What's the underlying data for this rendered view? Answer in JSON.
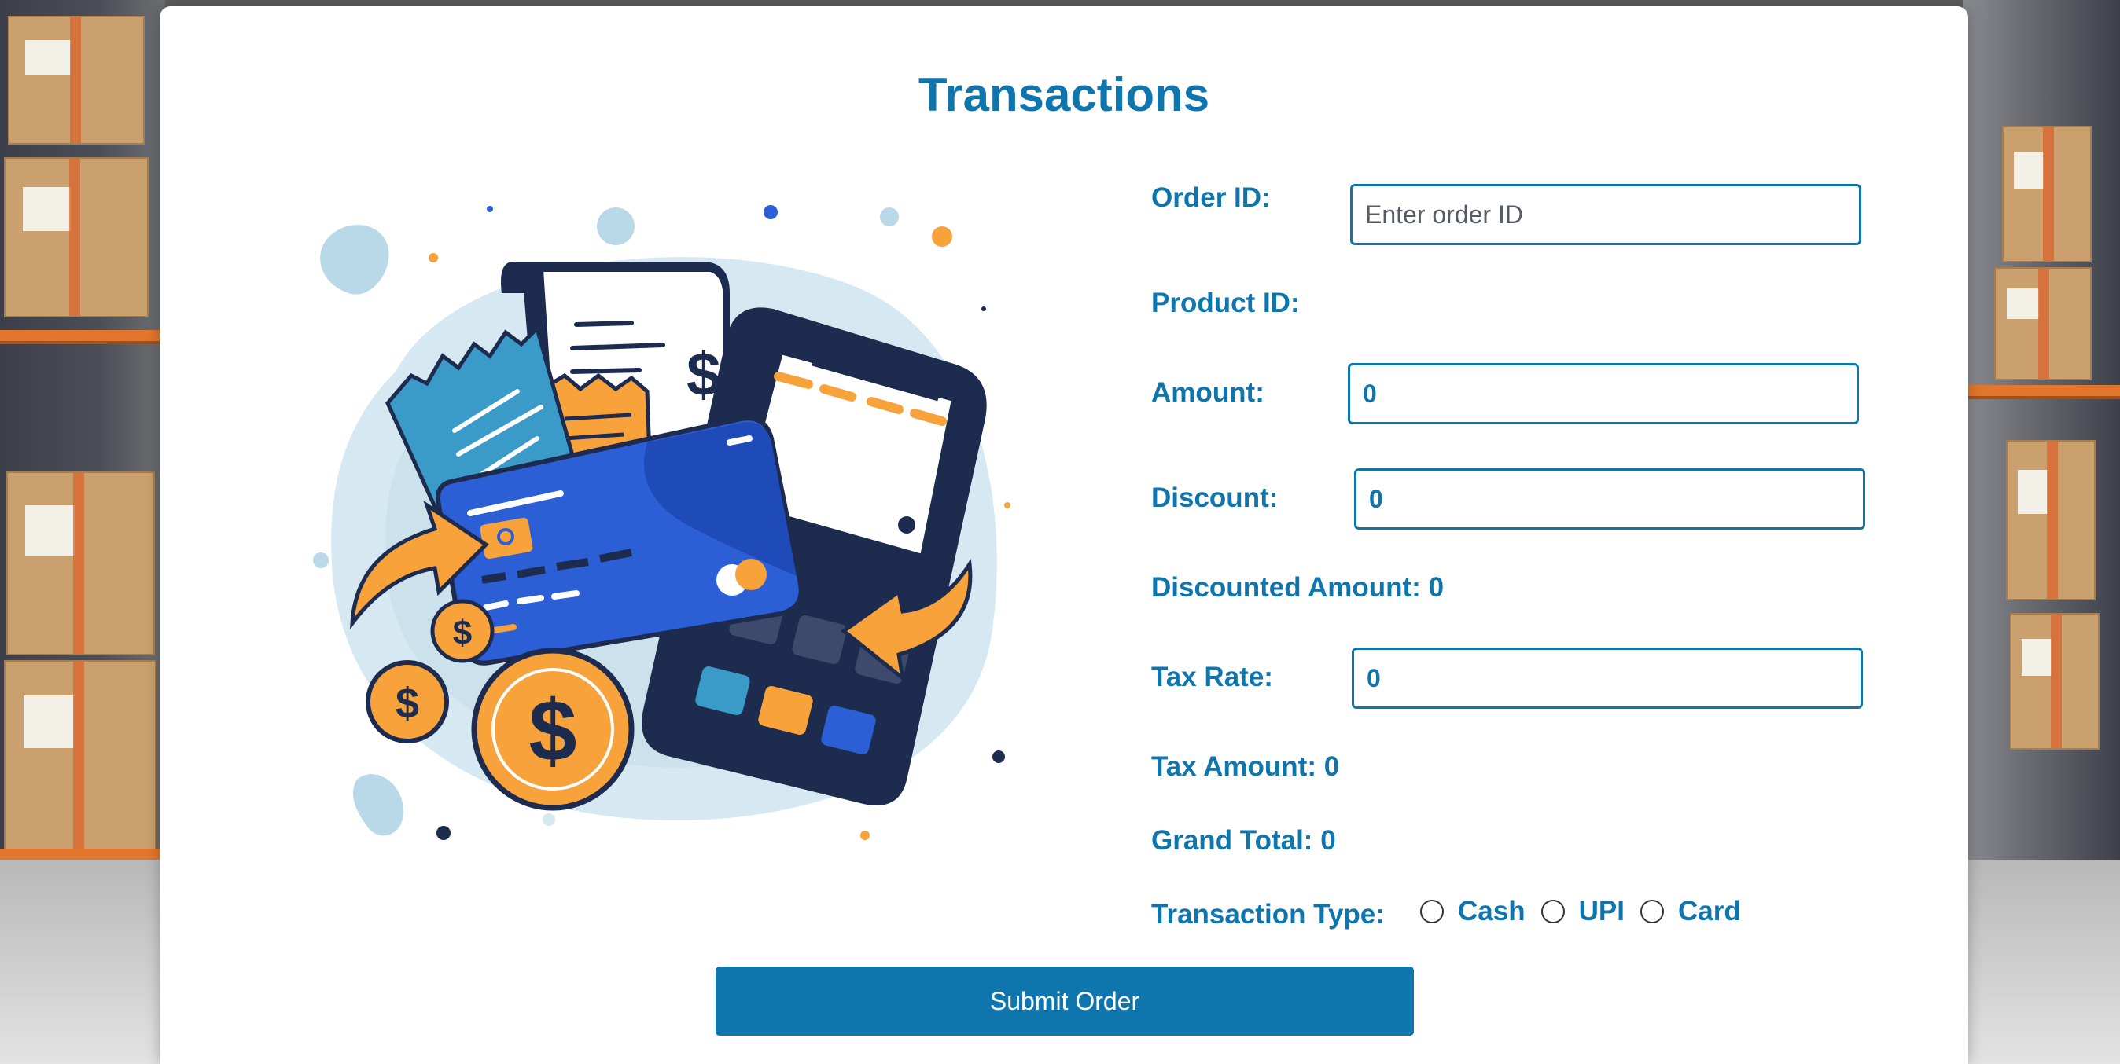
{
  "page": {
    "title": "Transactions"
  },
  "form": {
    "order_id": {
      "label": "Order ID:",
      "value": "",
      "placeholder": "Enter order ID"
    },
    "product_id": {
      "label": "Product ID:"
    },
    "amount": {
      "label": "Amount:",
      "value": "0"
    },
    "discount": {
      "label": "Discount:",
      "value": "0"
    },
    "discounted_amount": {
      "label": "Discounted Amount:",
      "value": "0"
    },
    "tax_rate": {
      "label": "Tax Rate:",
      "value": "0"
    },
    "tax_amount": {
      "label": "Tax Amount:",
      "value": "0"
    },
    "grand_total": {
      "label": "Grand Total:",
      "value": "0"
    },
    "transaction_type": {
      "label": "Transaction Type:",
      "options": [
        "Cash",
        "UPI",
        "Card"
      ],
      "selected": null
    },
    "submit_label": "Submit Order"
  },
  "illustration": {
    "icons": [
      "receipt-icon",
      "credit-card-icon",
      "calculator-icon",
      "dollar-coin-icon",
      "arrow-icon"
    ],
    "receipt_symbol": "$",
    "coin_symbol": "$"
  },
  "colors": {
    "primary": "#0f75ad",
    "card_blue": "#2c5fd6",
    "navy": "#1d2b4f",
    "orange": "#f7a23b",
    "light_blue": "#cfe3ee"
  }
}
